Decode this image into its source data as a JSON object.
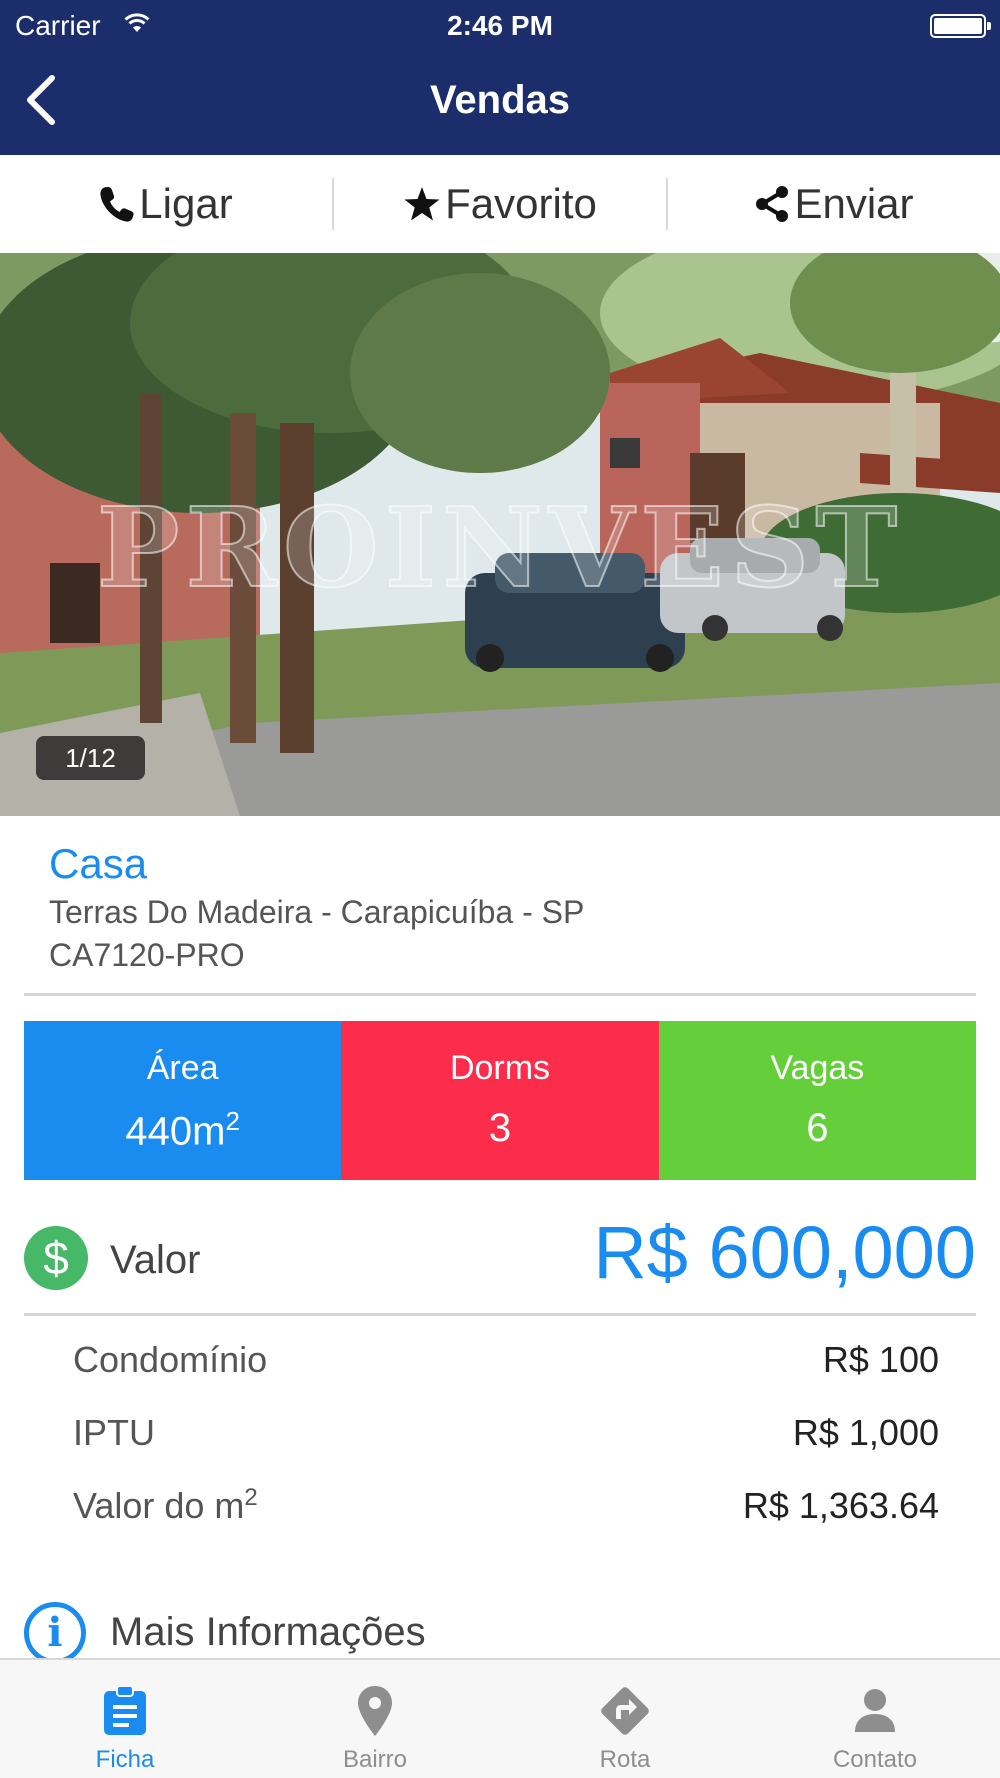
{
  "status_bar": {
    "carrier": "Carrier",
    "time": "2:46 PM"
  },
  "nav": {
    "title": "Vendas"
  },
  "actions": [
    {
      "label": "Ligar",
      "icon": "phone-icon"
    },
    {
      "label": "Favorito",
      "icon": "star-icon"
    },
    {
      "label": "Enviar",
      "icon": "share-icon"
    }
  ],
  "photo": {
    "counter": "1/12",
    "watermark": "PROINVEST"
  },
  "property": {
    "type": "Casa",
    "address": "Terras Do Madeira - Carapicuíba - SP",
    "code": "CA7120-PRO"
  },
  "stats": [
    {
      "label": "Área",
      "value": "440m",
      "sup": "2",
      "color": "#1a8cf0"
    },
    {
      "label": "Dorms",
      "value": "3",
      "color": "#fc2d4b"
    },
    {
      "label": "Vagas",
      "value": "6",
      "color": "#64cf3a"
    }
  ],
  "price": {
    "label": "Valor",
    "value": "R$ 600,000",
    "icon_symbol": "$"
  },
  "details": [
    {
      "label": "Condomínio",
      "value": "R$ 100"
    },
    {
      "label": "IPTU",
      "value": "R$ 1,000"
    },
    {
      "label": "Valor do m",
      "sup": "2",
      "value": "R$ 1,363.64"
    }
  ],
  "more_info": {
    "label": "Mais Informações",
    "icon_symbol": "i"
  },
  "tabs": [
    {
      "label": "Ficha",
      "icon": "clipboard-icon",
      "active": true
    },
    {
      "label": "Bairro",
      "icon": "map-pin-icon",
      "active": false
    },
    {
      "label": "Rota",
      "icon": "route-arrow-icon",
      "active": false
    },
    {
      "label": "Contato",
      "icon": "person-icon",
      "active": false
    }
  ],
  "colors": {
    "nav_bg": "#1b2e6b",
    "accent": "#1a8cf0",
    "area": "#1a8cf0",
    "dorms": "#fc2d4b",
    "vagas": "#64cf3a",
    "money_icon": "#46b868"
  }
}
